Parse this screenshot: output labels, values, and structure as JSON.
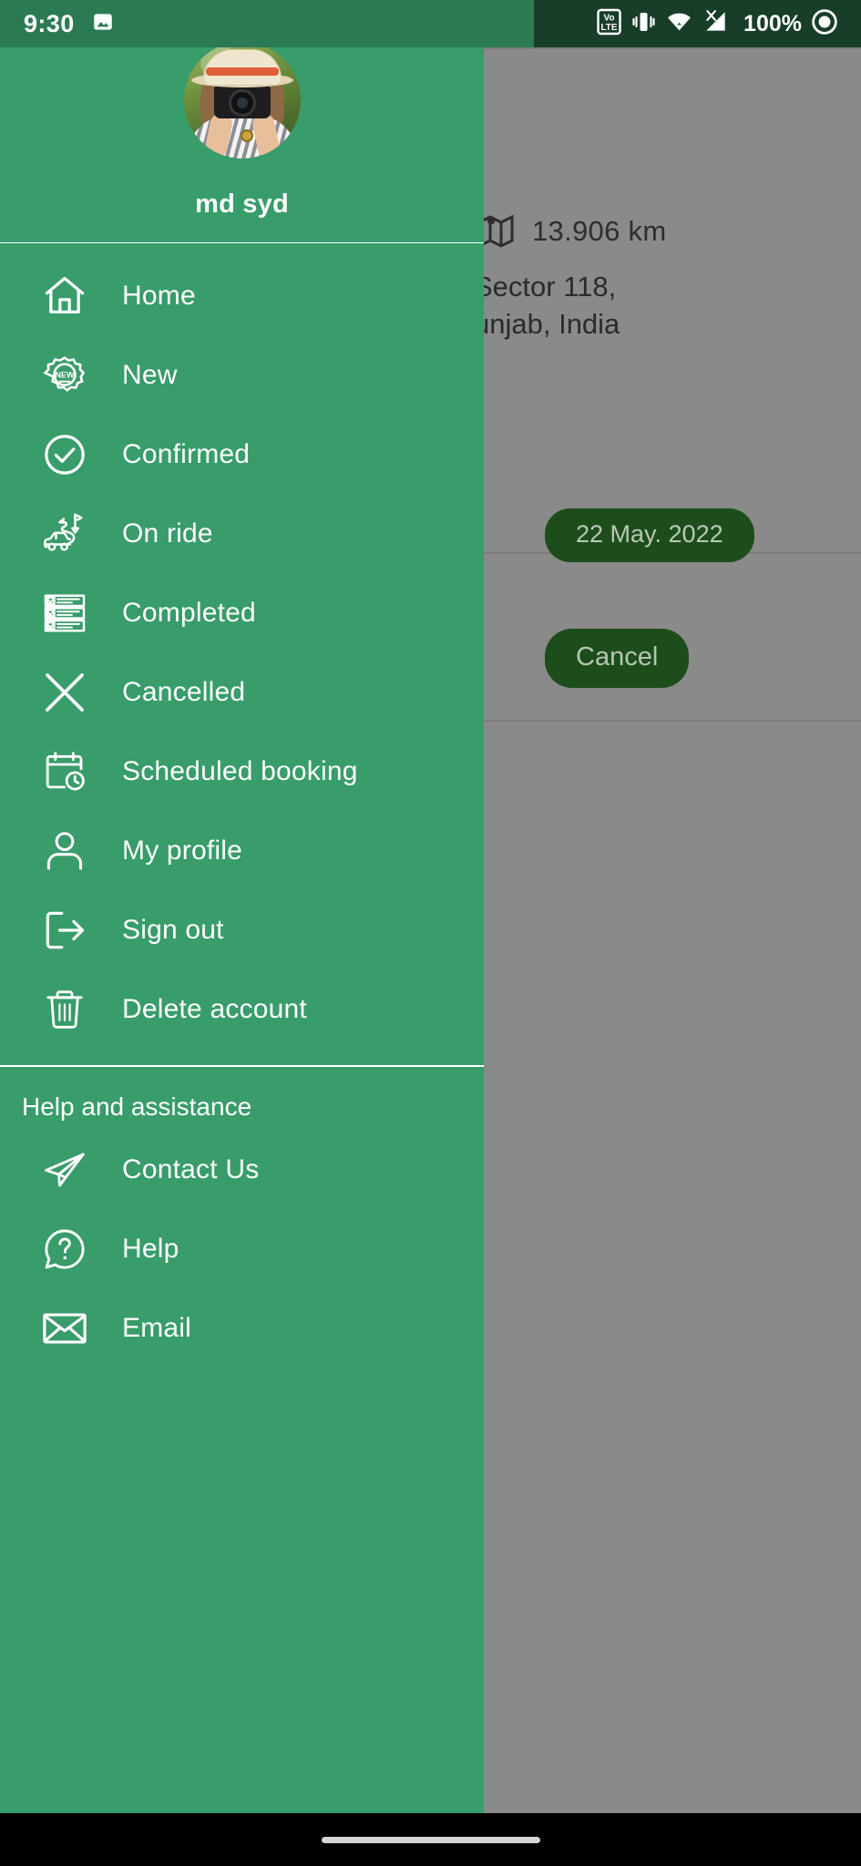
{
  "status_bar": {
    "time": "9:30",
    "battery": "100%",
    "icons": [
      "image-icon",
      "volte-icon",
      "vibrate-icon",
      "wifi-icon",
      "signal-no-service-icon",
      "record-icon"
    ],
    "volte_top": "Vo",
    "volte_bottom": "LTE",
    "signal_x": "X"
  },
  "drawer": {
    "profile": {
      "name": "md syd",
      "avatar_alt": "user-avatar-photo"
    },
    "menu": [
      {
        "label": "Home",
        "icon": "home-icon"
      },
      {
        "label": "New",
        "icon": "new-badge-icon",
        "badge_text": "NEW"
      },
      {
        "label": "Confirmed",
        "icon": "check-circle-icon"
      },
      {
        "label": "On ride",
        "icon": "car-route-icon"
      },
      {
        "label": "Completed",
        "icon": "checklist-icon"
      },
      {
        "label": "Cancelled",
        "icon": "close-x-icon"
      },
      {
        "label": "Scheduled booking",
        "icon": "calendar-clock-icon"
      },
      {
        "label": "My profile",
        "icon": "person-icon"
      },
      {
        "label": "Sign out",
        "icon": "sign-out-icon"
      },
      {
        "label": "Delete account",
        "icon": "trash-icon"
      }
    ],
    "help_section": {
      "title": "Help and assistance",
      "items": [
        {
          "label": "Contact Us",
          "icon": "paper-plane-icon"
        },
        {
          "label": "Help",
          "icon": "question-bubble-icon"
        },
        {
          "label": "Email",
          "icon": "envelope-icon"
        }
      ]
    }
  },
  "background": {
    "distance": "13.906 km",
    "distance_icon": "map-pin-icon",
    "address": "Sector 118,\nunjab, India",
    "date_badge": "22 May. 2022",
    "cancel_label": "Cancel"
  },
  "colors": {
    "drawer_green": "#389c6b",
    "status_green": "#2b7a54",
    "status_dark": "#183d28",
    "pill_dark_green": "#1e4d1c",
    "scrim_gray": "#8a8a8a",
    "text_white": "#ffffff"
  },
  "nav_bar": {
    "gesture_pill": "home-gesture-pill"
  }
}
